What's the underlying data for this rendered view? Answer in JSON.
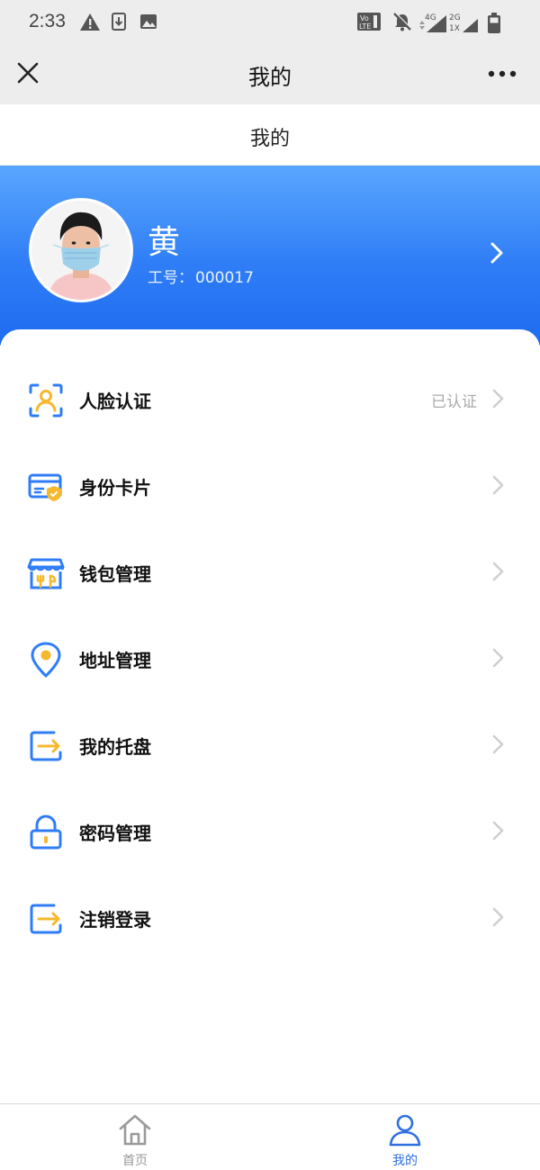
{
  "status_bar": {
    "time": "2:33",
    "icons": [
      "warning-icon",
      "download-icon",
      "image-icon",
      "volte-icon",
      "mute-icon",
      "signal-4g-icon",
      "signal-2g-icon",
      "battery-icon"
    ]
  },
  "title_bar": {
    "title": "我的",
    "close_icon": "close-icon",
    "more_icon": "more-icon"
  },
  "page_header": {
    "title": "我的"
  },
  "profile": {
    "name": "黄",
    "employee_id_label": "工号：",
    "employee_id": "000017"
  },
  "menu": {
    "items": [
      {
        "label": "人脸认证",
        "value": "已认证",
        "icon": "face-verify-icon"
      },
      {
        "label": "身份卡片",
        "value": "",
        "icon": "id-card-icon"
      },
      {
        "label": "钱包管理",
        "value": "",
        "icon": "wallet-shop-icon"
      },
      {
        "label": "地址管理",
        "value": "",
        "icon": "location-pin-icon"
      },
      {
        "label": "我的托盘",
        "value": "",
        "icon": "tray-arrow-icon"
      },
      {
        "label": "密码管理",
        "value": "",
        "icon": "lock-icon"
      },
      {
        "label": "注销登录",
        "value": "",
        "icon": "logout-icon"
      }
    ]
  },
  "bottom_nav": {
    "items": [
      {
        "label": "首页",
        "icon": "home-icon",
        "active": false
      },
      {
        "label": "我的",
        "icon": "person-icon",
        "active": true
      }
    ]
  },
  "colors": {
    "banner_top": "#59a6ff",
    "banner_bottom": "#1e6cf0",
    "icon_blue": "#2f7df6",
    "icon_yellow": "#f5b82e",
    "active_nav": "#2f6fe0",
    "inactive_nav": "#999999",
    "chrome_gray": "#ededed"
  }
}
